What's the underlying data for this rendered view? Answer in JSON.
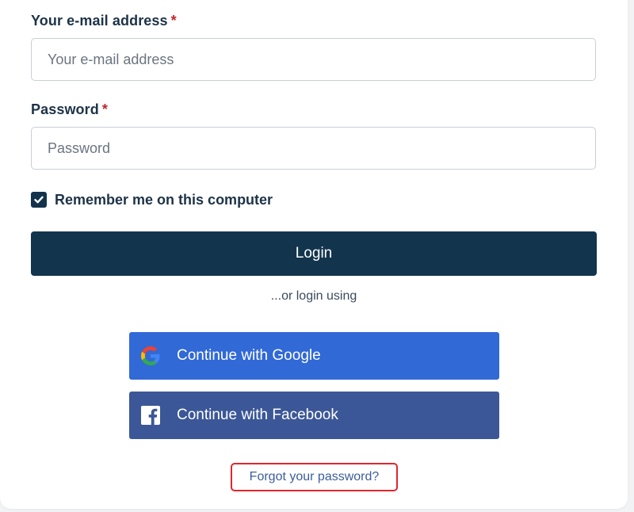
{
  "email": {
    "label": "Your e-mail address",
    "required_mark": "*",
    "placeholder": "Your e-mail address",
    "value": ""
  },
  "password": {
    "label": "Password",
    "required_mark": "*",
    "placeholder": "Password",
    "value": ""
  },
  "remember": {
    "label": "Remember me on this computer",
    "checked": true
  },
  "login_button": "Login",
  "or_text": "...or login using",
  "social": {
    "google": {
      "label": "Continue with Google",
      "icon": "google-icon",
      "color": "#3169d6"
    },
    "facebook": {
      "label": "Continue with Facebook",
      "icon": "facebook-icon",
      "color": "#3b5797"
    }
  },
  "forgot_password": "Forgot your password?",
  "colors": {
    "primary": "#13344d",
    "required": "#c0262d",
    "link": "#3c5d9d",
    "highlight_border": "#e0262d"
  }
}
